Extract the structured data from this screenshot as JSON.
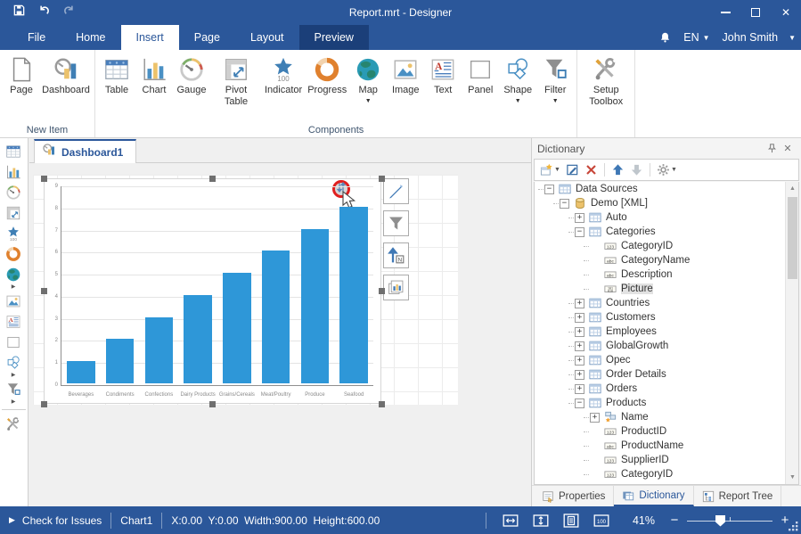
{
  "titlebar": {
    "title": "Report.mrt - Designer"
  },
  "menu": {
    "tabs": [
      {
        "label": "File",
        "state": "normal"
      },
      {
        "label": "Home",
        "state": "normal"
      },
      {
        "label": "Insert",
        "state": "active"
      },
      {
        "label": "Page",
        "state": "normal"
      },
      {
        "label": "Layout",
        "state": "normal"
      },
      {
        "label": "Preview",
        "state": "highlighted"
      }
    ],
    "language": "EN",
    "user": "John Smith"
  },
  "ribbon": {
    "groups": [
      {
        "caption": "New Item",
        "items": [
          {
            "label": "Page",
            "icon": "page"
          },
          {
            "label": "Dashboard",
            "icon": "dashboard"
          }
        ]
      },
      {
        "caption": "Components",
        "items": [
          {
            "label": "Table",
            "icon": "table"
          },
          {
            "label": "Chart",
            "icon": "chart"
          },
          {
            "label": "Gauge",
            "icon": "gauge"
          },
          {
            "label": "Pivot Table",
            "icon": "pivot-table"
          },
          {
            "label": "Indicator",
            "icon": "indicator"
          },
          {
            "label": "Progress",
            "icon": "progress"
          },
          {
            "label": "Map",
            "icon": "map",
            "dropdown": true
          },
          {
            "label": "Image",
            "icon": "image"
          },
          {
            "label": "Text",
            "icon": "text"
          },
          {
            "label": "Panel",
            "icon": "panel"
          },
          {
            "label": "Shape",
            "icon": "shape",
            "dropdown": true
          },
          {
            "label": "Filter",
            "icon": "filter",
            "dropdown": true
          }
        ]
      },
      {
        "caption": "",
        "items": [
          {
            "label": "Setup Toolbox",
            "icon": "setup-toolbox"
          }
        ]
      }
    ]
  },
  "sidebar": {
    "items": [
      {
        "icon": "table"
      },
      {
        "icon": "chart"
      },
      {
        "icon": "gauge"
      },
      {
        "icon": "pivot-table"
      },
      {
        "icon": "indicator"
      },
      {
        "icon": "progress"
      },
      {
        "icon": "map",
        "dropdown": true
      },
      {
        "icon": "image"
      },
      {
        "icon": "text"
      },
      {
        "icon": "panel"
      },
      {
        "icon": "shape",
        "dropdown": true
      },
      {
        "icon": "filter",
        "dropdown": true
      },
      {
        "icon": "setup-toolbox",
        "separated": true
      }
    ]
  },
  "canvas": {
    "tab": {
      "label": "Dashboard1"
    },
    "chart_data": {
      "type": "bar",
      "categories": [
        "Beverages",
        "Condiments",
        "Confections",
        "Dairy Products",
        "Grains/Cereals",
        "Meat/Poultry",
        "Produce",
        "Seafood"
      ],
      "values": [
        1,
        2,
        3,
        4,
        5,
        6,
        7,
        8
      ],
      "y_ticks": [
        0,
        1,
        2,
        3,
        4,
        5,
        6,
        7,
        8,
        9
      ],
      "ylim": [
        0,
        9
      ],
      "bar_color": "#2E97D8",
      "grid": true,
      "legend": false,
      "title": ""
    },
    "float_tools": [
      {
        "icon": "edit-pencil"
      },
      {
        "icon": "filter-funnel"
      },
      {
        "icon": "sort-ascending"
      },
      {
        "icon": "chart-type"
      }
    ]
  },
  "dictionary": {
    "title": "Dictionary",
    "toolbar": [
      {
        "icon": "new-item",
        "dropdown": true
      },
      {
        "icon": "edit-item"
      },
      {
        "icon": "delete-item"
      },
      {
        "sep": true
      },
      {
        "icon": "move-up"
      },
      {
        "icon": "move-down",
        "disabled": true
      },
      {
        "sep": true
      },
      {
        "icon": "settings-gear",
        "dropdown": true
      }
    ],
    "tree": [
      {
        "label": "Data Sources",
        "depth": 0,
        "expand": "minus",
        "icon": "ds-table"
      },
      {
        "label": "Demo [XML]",
        "depth": 1,
        "expand": "minus",
        "icon": "ds-database"
      },
      {
        "label": "Auto",
        "depth": 2,
        "expand": "plus",
        "icon": "ds-table"
      },
      {
        "label": "Categories",
        "depth": 2,
        "expand": "minus",
        "icon": "ds-table"
      },
      {
        "label": "CategoryID",
        "depth": 3,
        "icon": "field-123"
      },
      {
        "label": "CategoryName",
        "depth": 3,
        "icon": "field-abc"
      },
      {
        "label": "Description",
        "depth": 3,
        "icon": "field-abc"
      },
      {
        "label": "Picture",
        "depth": 3,
        "icon": "field-bin",
        "selected": true
      },
      {
        "label": "Countries",
        "depth": 2,
        "expand": "plus",
        "icon": "ds-table"
      },
      {
        "label": "Customers",
        "depth": 2,
        "expand": "plus",
        "icon": "ds-table"
      },
      {
        "label": "Employees",
        "depth": 2,
        "expand": "plus",
        "icon": "ds-table"
      },
      {
        "label": "GlobalGrowth",
        "depth": 2,
        "expand": "plus",
        "icon": "ds-table"
      },
      {
        "label": "Opec",
        "depth": 2,
        "expand": "plus",
        "icon": "ds-table"
      },
      {
        "label": "Order Details",
        "depth": 2,
        "expand": "plus",
        "icon": "ds-table"
      },
      {
        "label": "Orders",
        "depth": 2,
        "expand": "plus",
        "icon": "ds-table"
      },
      {
        "label": "Products",
        "depth": 2,
        "expand": "minus",
        "icon": "ds-table"
      },
      {
        "label": "Name",
        "depth": 3,
        "expand": "plus",
        "icon": "ds-relation"
      },
      {
        "label": "ProductID",
        "depth": 3,
        "icon": "field-123"
      },
      {
        "label": "ProductName",
        "depth": 3,
        "icon": "field-abc"
      },
      {
        "label": "SupplierID",
        "depth": 3,
        "icon": "field-123"
      },
      {
        "label": "CategoryID",
        "depth": 3,
        "icon": "field-123"
      }
    ],
    "tabs": [
      {
        "label": "Properties",
        "icon": "tab-properties"
      },
      {
        "label": "Dictionary",
        "icon": "tab-dictionary",
        "active": true
      },
      {
        "label": "Report Tree",
        "icon": "tab-report-tree"
      }
    ]
  },
  "statusbar": {
    "check": "Check for Issues",
    "component": "Chart1",
    "coords": "X:0.00  Y:0.00  Width:900.00  Height:600.00",
    "zoom": "41%",
    "zoom_icons": [
      "fit-width",
      "fit-height",
      "fit-page",
      "zoom-100"
    ]
  }
}
